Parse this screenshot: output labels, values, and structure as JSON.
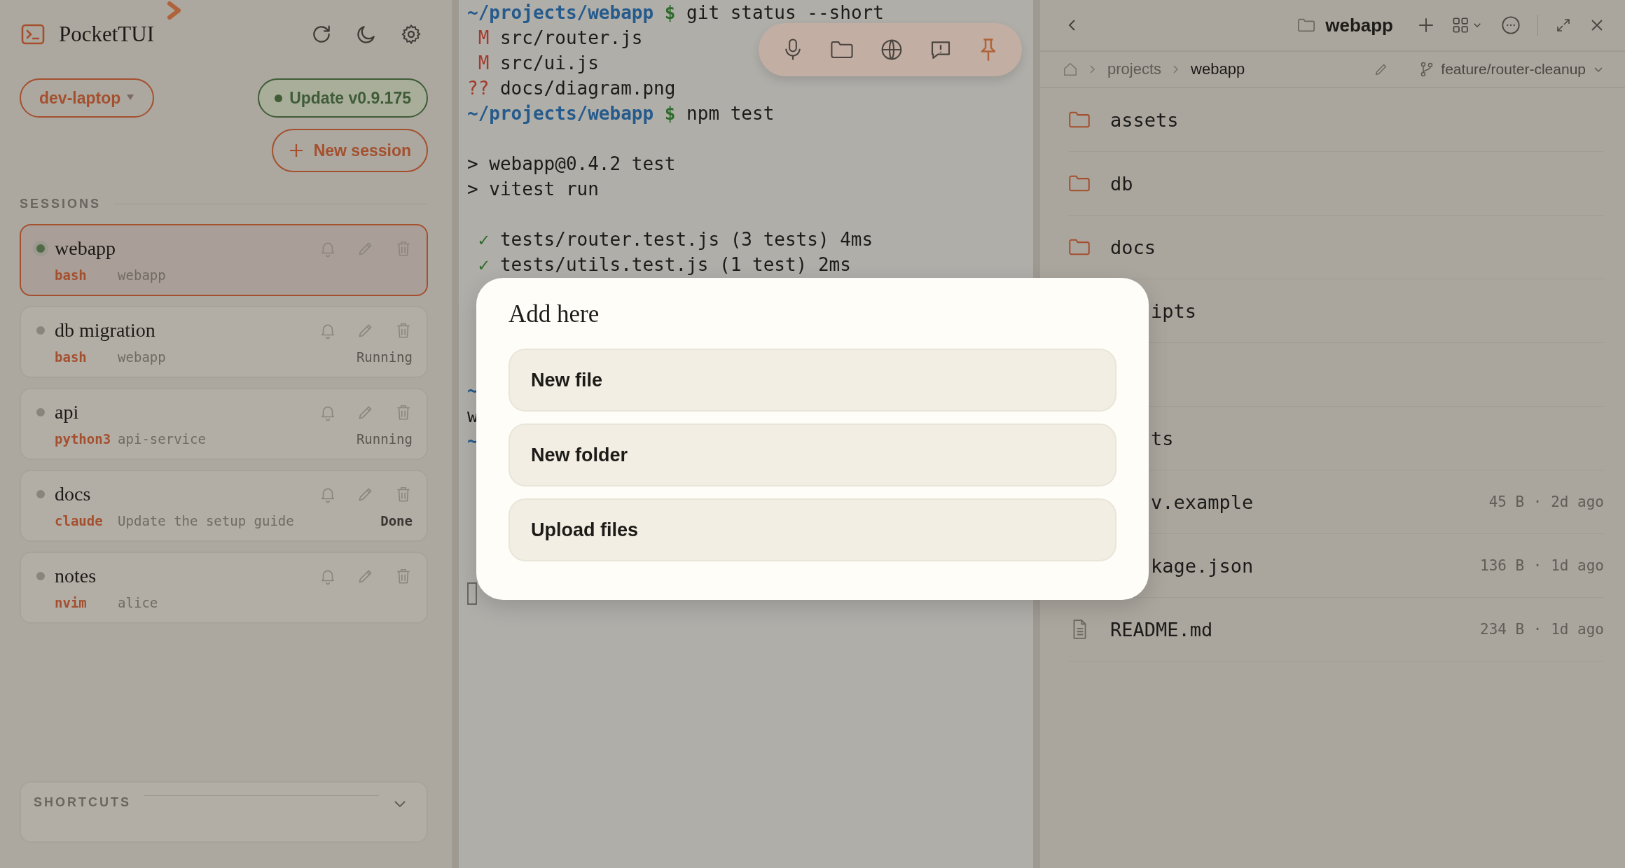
{
  "sidebar": {
    "app_title": "PocketTUI",
    "host": "dev-laptop",
    "update_badge": "Update v0.9.175",
    "new_session": "New session",
    "sessions_heading": "SESSIONS",
    "sessions": [
      {
        "name": "webapp",
        "shell": "bash",
        "detail": "webapp",
        "selected": true,
        "color": "#4f6a45"
      },
      {
        "name": "db migration",
        "shell": "bash",
        "detail": "webapp",
        "status": "Running",
        "status_bold": false,
        "selected": false,
        "color": "#8a857c"
      },
      {
        "name": "api",
        "shell": "python3",
        "detail": "api-service",
        "status": "Running",
        "status_bold": false,
        "selected": false,
        "color": "#8a857c"
      },
      {
        "name": "docs",
        "shell": "claude",
        "detail": "Update the setup guide",
        "status": "Done",
        "status_bold": true,
        "selected": false,
        "color": "#8a857c"
      },
      {
        "name": "notes",
        "shell": "nvim",
        "detail": "alice",
        "selected": false,
        "color": "#8a857c"
      }
    ],
    "shortcuts": {
      "heading": "SHORTCUTS",
      "expanded": false
    }
  },
  "terminal": {
    "lines": [
      {
        "kind": "text",
        "segments": [
          {
            "text": "~/projects/webapp",
            "kind": "path"
          },
          {
            "text": " $",
            "kind": "prompt"
          },
          {
            "text": " git status --short",
            "kind": "plain"
          }
        ]
      },
      {
        "kind": "text",
        "segments": [
          {
            "text": " M",
            "kind": "status"
          },
          {
            "text": " src/router.js",
            "kind": "plain"
          }
        ]
      },
      {
        "kind": "text",
        "segments": [
          {
            "text": " M",
            "kind": "status"
          },
          {
            "text": " src/ui.js",
            "kind": "plain"
          }
        ]
      },
      {
        "kind": "text",
        "segments": [
          {
            "text": "??",
            "kind": "status"
          },
          {
            "text": " docs/diagram.png",
            "kind": "plain"
          }
        ]
      },
      {
        "kind": "text",
        "segments": [
          {
            "text": "~/projects/webapp",
            "kind": "path"
          },
          {
            "text": " $",
            "kind": "prompt"
          },
          {
            "text": " npm test",
            "kind": "plain"
          }
        ]
      },
      {
        "kind": "blank"
      },
      {
        "kind": "text",
        "segments": [
          {
            "text": "> webapp@0.4.2 test",
            "kind": "plain"
          }
        ]
      },
      {
        "kind": "text",
        "segments": [
          {
            "text": "> vitest run",
            "kind": "plain"
          }
        ]
      },
      {
        "kind": "blank"
      },
      {
        "kind": "text",
        "segments": [
          {
            "text": " ✓",
            "kind": "check"
          },
          {
            "text": " tests/router.test.js (3 tests) 4ms",
            "kind": "plain"
          }
        ]
      },
      {
        "kind": "text",
        "segments": [
          {
            "text": " ✓",
            "kind": "check"
          },
          {
            "text": " tests/utils.test.js (1 test) 2ms",
            "kind": "plain"
          }
        ]
      },
      {
        "kind": "blank"
      },
      {
        "kind": "blank"
      },
      {
        "kind": "blank"
      },
      {
        "kind": "blank"
      },
      {
        "kind": "text",
        "segments": [
          {
            "text": "~",
            "kind": "path"
          }
        ]
      },
      {
        "kind": "text",
        "segments": [
          {
            "text": "w",
            "kind": "plain"
          }
        ]
      },
      {
        "kind": "text",
        "segments": [
          {
            "text": "~",
            "kind": "path"
          }
        ]
      },
      {
        "kind": "blank"
      },
      {
        "kind": "blank"
      },
      {
        "kind": "blank"
      },
      {
        "kind": "blank"
      },
      {
        "kind": "blank"
      },
      {
        "kind": "cursor"
      }
    ]
  },
  "files": {
    "title": "webapp",
    "breadcrumb": [
      {
        "label": "projects",
        "selected": false
      },
      {
        "label": "webapp",
        "selected": true
      }
    ],
    "branch": "feature/router-cleanup",
    "rows": [
      {
        "kind": "folder",
        "name": "assets"
      },
      {
        "kind": "folder",
        "name": "db"
      },
      {
        "kind": "folder",
        "name": "docs"
      },
      {
        "kind": "covered",
        "name": "ipts"
      },
      {
        "kind": "covered"
      },
      {
        "kind": "covered",
        "name": "ts"
      },
      {
        "kind": "covered",
        "name": "v.example",
        "meta": "45 B · 2d ago"
      },
      {
        "kind": "covered",
        "name": "kage.json",
        "meta": "136 B · 1d ago"
      },
      {
        "kind": "file",
        "name": "README.md",
        "meta": "234 B · 1d ago"
      }
    ]
  },
  "dialog": {
    "title": "Add here",
    "options": [
      "New file",
      "New folder",
      "Upload files"
    ]
  }
}
